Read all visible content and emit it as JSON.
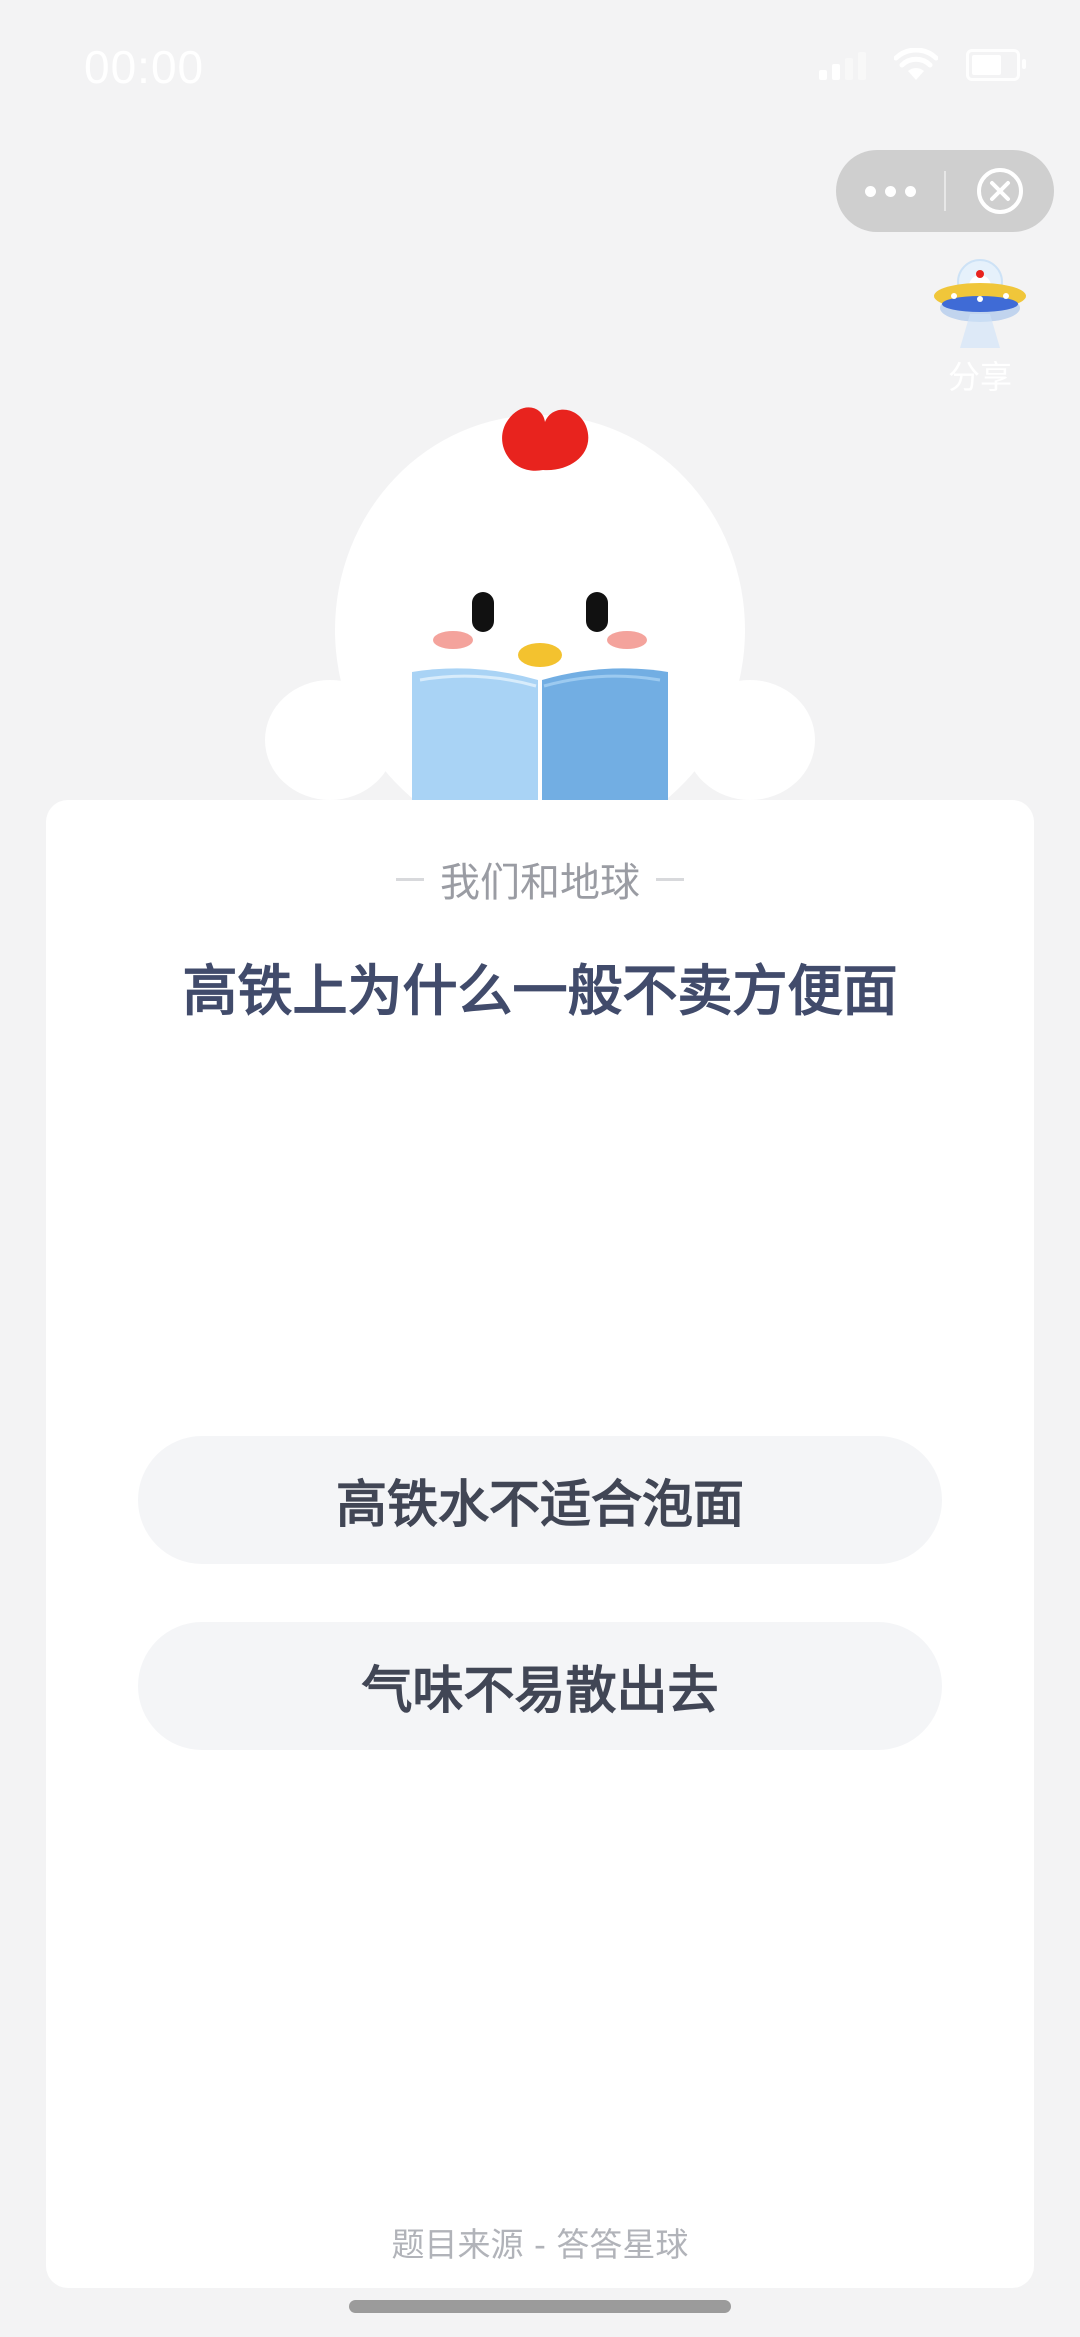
{
  "status_bar": {
    "time": "00:00"
  },
  "capsule": {
    "more_icon": "ellipsis-icon",
    "close_icon": "circle-close-icon"
  },
  "share": {
    "label": "分享",
    "icon": "ufo-icon"
  },
  "quiz": {
    "category": "我们和地球",
    "question": "高铁上为什么一般不卖方便面",
    "options": [
      {
        "label": "高铁水不适合泡面"
      },
      {
        "label": "气味不易散出去"
      }
    ],
    "source": "题目来源 - 答答星球"
  },
  "colors": {
    "background": "#f3f3f4",
    "question_text": "#414b6b",
    "option_bg": "#f4f5f7",
    "comb_red": "#e8231e",
    "book_blue": "#8cc2ee"
  }
}
